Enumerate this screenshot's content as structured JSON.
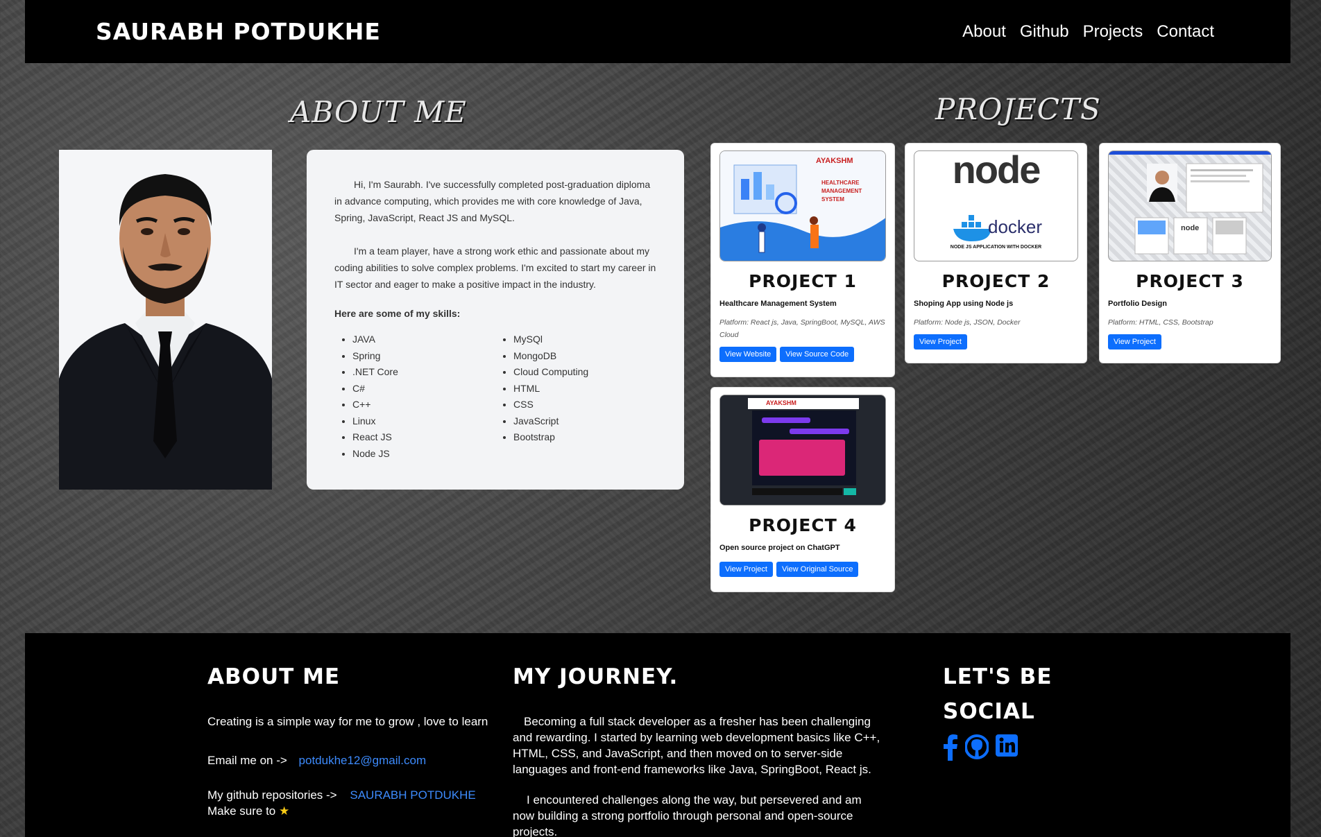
{
  "nav": {
    "brand": "SAURABH POTDUKHE",
    "links": [
      "About",
      "Github",
      "Projects",
      "Contact"
    ]
  },
  "about_heading": "ABOUT ME",
  "projects_heading": "PROJECTS",
  "about": {
    "para1": "Hi, I'm Saurabh. I've successfully completed post-graduation diploma in advance computing, which provides me with core knowledge of Java, Spring, JavaScript, React JS and MySQL.",
    "para2": "I'm a team player, have a strong work ethic and passionate about my coding abilities to solve complex problems. I'm excited to start my career in IT sector and eager to make a positive impact in the industry.",
    "skills_title": "Here are some of my skills:",
    "skills_left": [
      "JAVA",
      "Spring",
      ".NET Core",
      "C#",
      "C++",
      "Linux",
      "React JS",
      "Node JS"
    ],
    "skills_right": [
      "MySQl",
      "MongoDB",
      "Cloud Computing",
      "HTML",
      "CSS",
      "JavaScript",
      "Bootstrap"
    ]
  },
  "projects": [
    {
      "title": "PROJECT 1",
      "subtitle": "Healthcare Management System",
      "tech": "Platform: React js, Java, SpringBoot, MySQL, AWS Cloud",
      "buttons": [
        "View Website",
        "View Source Code"
      ],
      "thumb_brand": "AYAKSHM",
      "thumb_text": "HEALTHCARE MANAGEMENT SYSTEM"
    },
    {
      "title": "PROJECT 2",
      "subtitle": "Shoping App using Node js",
      "tech": "Platform: Node js, JSON, Docker",
      "buttons": [
        "View Project"
      ],
      "thumb_word1": "node",
      "thumb_word2": "docker",
      "thumb_caption": "NODE JS APPLICATION WITH DOCKER"
    },
    {
      "title": "PROJECT 3",
      "subtitle": "Portfolio Design",
      "tech": "Platform: HTML, CSS, Bootstrap",
      "buttons": [
        "View Project"
      ]
    },
    {
      "title": "PROJECT 4",
      "subtitle": "Open source project on ChatGPT",
      "tech": "",
      "buttons": [
        "View Project",
        "View Original Source"
      ],
      "thumb_brand": "AYAKSHM"
    }
  ],
  "footer": {
    "about_title": "ABOUT ME",
    "tagline": "Creating is a simple way for me to grow , love to learn",
    "email_label": "Email me on ->",
    "email": "potdukhe12@gmail.com",
    "github_label": "My github repositories ->",
    "github_name": "SAURABH POTDUKHE",
    "make_sure": "Make sure to",
    "star_icon": "star-icon",
    "journey_title": "MY JOURNEY.",
    "journey_p1": "Becoming a full stack developer as a fresher has been challenging and rewarding. I started by learning web development basics like C++, HTML, CSS, and JavaScript, and then moved on to server-side languages and front-end frameworks like Java, SpringBoot, React js.",
    "journey_p2": "I encountered challenges along the way, but persevered and am now building a strong portfolio through personal and open-source projects.",
    "social_title_1": "LET'S BE",
    "social_title_2": "SOCIAL",
    "social_icons": [
      "facebook-icon",
      "github-icon",
      "linkedin-icon"
    ],
    "social_color": "#0d6efd"
  }
}
